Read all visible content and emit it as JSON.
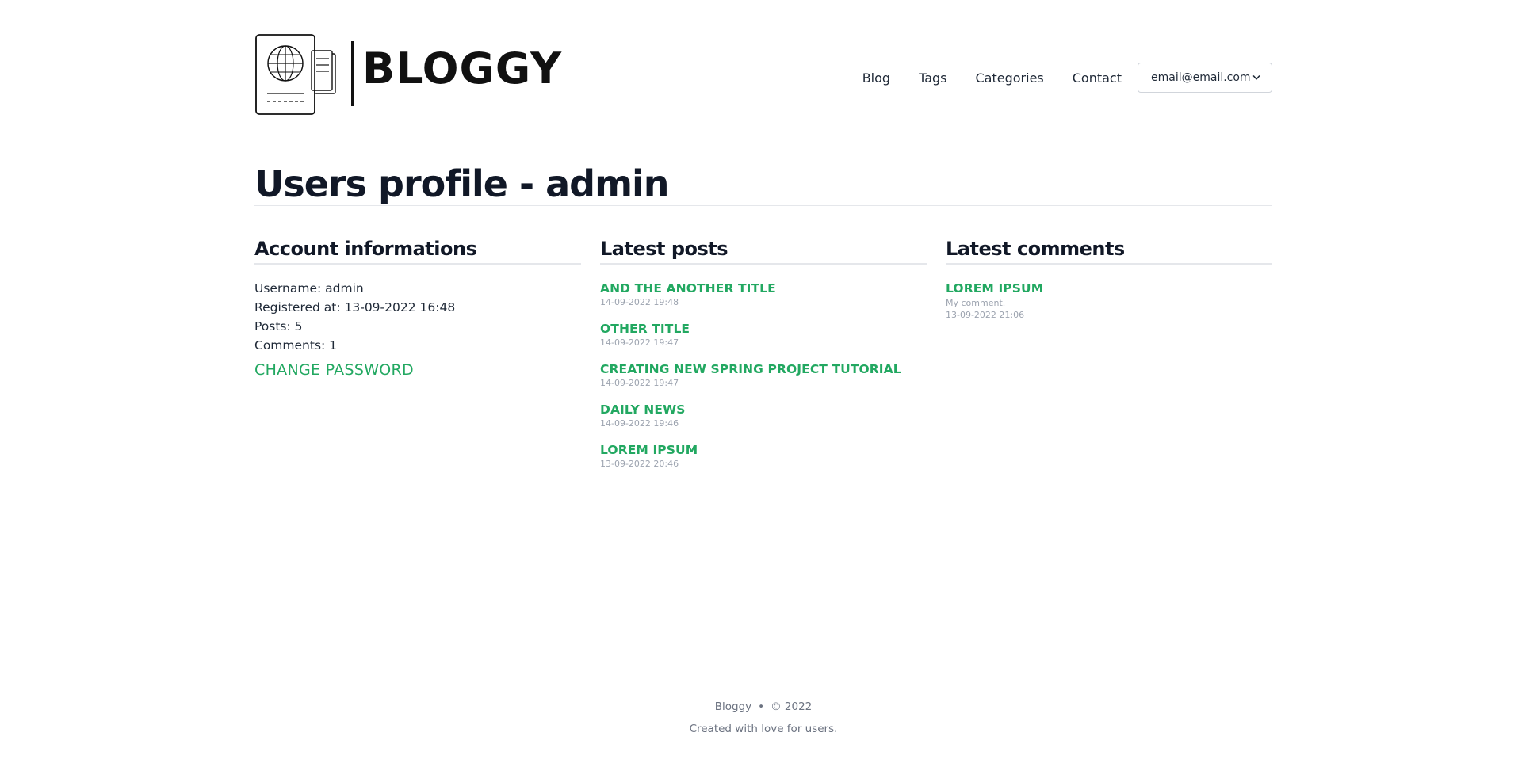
{
  "header": {
    "logo_text": "BLOGGY",
    "nav": [
      "Blog",
      "Tags",
      "Categories",
      "Contact"
    ],
    "account_email": "email@email.com"
  },
  "page": {
    "title": "Users profile - admin"
  },
  "account": {
    "heading": "Account informations",
    "username": "Username: admin",
    "registered": "Registered at: 13-09-2022 16:48",
    "posts": "Posts: 5",
    "comments": "Comments: 1",
    "change_password": "CHANGE PASSWORD"
  },
  "latest_posts": {
    "heading": "Latest posts",
    "items": [
      {
        "title": "AND THE ANOTHER TITLE",
        "date": "14-09-2022 19:48"
      },
      {
        "title": "OTHER TITLE",
        "date": "14-09-2022 19:47"
      },
      {
        "title": "CREATING NEW SPRING PROJECT TUTORIAL",
        "date": "14-09-2022 19:47"
      },
      {
        "title": "DAILY NEWS",
        "date": "14-09-2022 19:46"
      },
      {
        "title": "LOREM IPSUM",
        "date": "13-09-2022 20:46"
      }
    ]
  },
  "latest_comments": {
    "heading": "Latest comments",
    "items": [
      {
        "title": "LOREM IPSUM",
        "text": "My comment.",
        "date": "13-09-2022 21:06"
      }
    ]
  },
  "footer": {
    "brand": "Bloggy",
    "separator": "•",
    "copyright": "© 2022",
    "tagline": "Created with love for users."
  },
  "colors": {
    "accent": "#22a861",
    "heading": "#111827",
    "muted": "#9ca3af"
  },
  "icons": [
    "passport-logo-icon",
    "chevron-down-icon"
  ]
}
